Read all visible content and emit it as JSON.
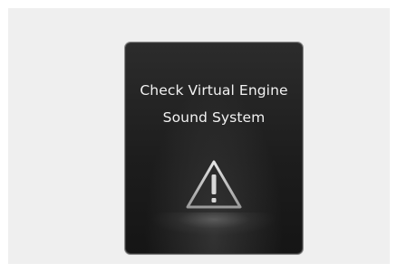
{
  "warning_panel": {
    "message_lines": [
      "Check Virtual Engine",
      "Sound System"
    ],
    "icon": "warning-triangle-icon"
  }
}
